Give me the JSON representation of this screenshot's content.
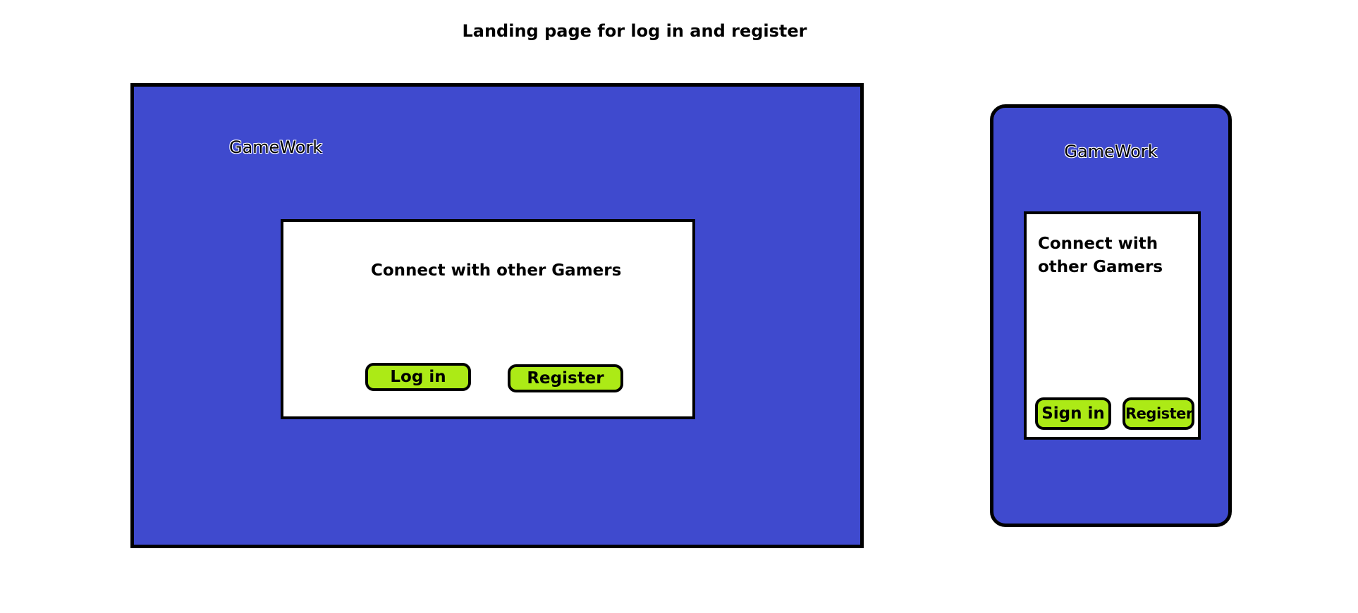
{
  "title": "Landing page for log in and register",
  "desktop": {
    "brand": "GameWork",
    "tagline": "Connect with other Gamers",
    "login_label": "Log in",
    "register_label": "Register"
  },
  "mobile": {
    "brand": "GameWork",
    "tagline": "Connect with other Gamers",
    "signin_label": "Sign in",
    "register_label": "Register"
  },
  "colors": {
    "background": "#ffffff",
    "frame_fill": "#3f4ace",
    "card_fill": "#ffffff",
    "button_fill": "#acea16",
    "outline": "#000000"
  }
}
